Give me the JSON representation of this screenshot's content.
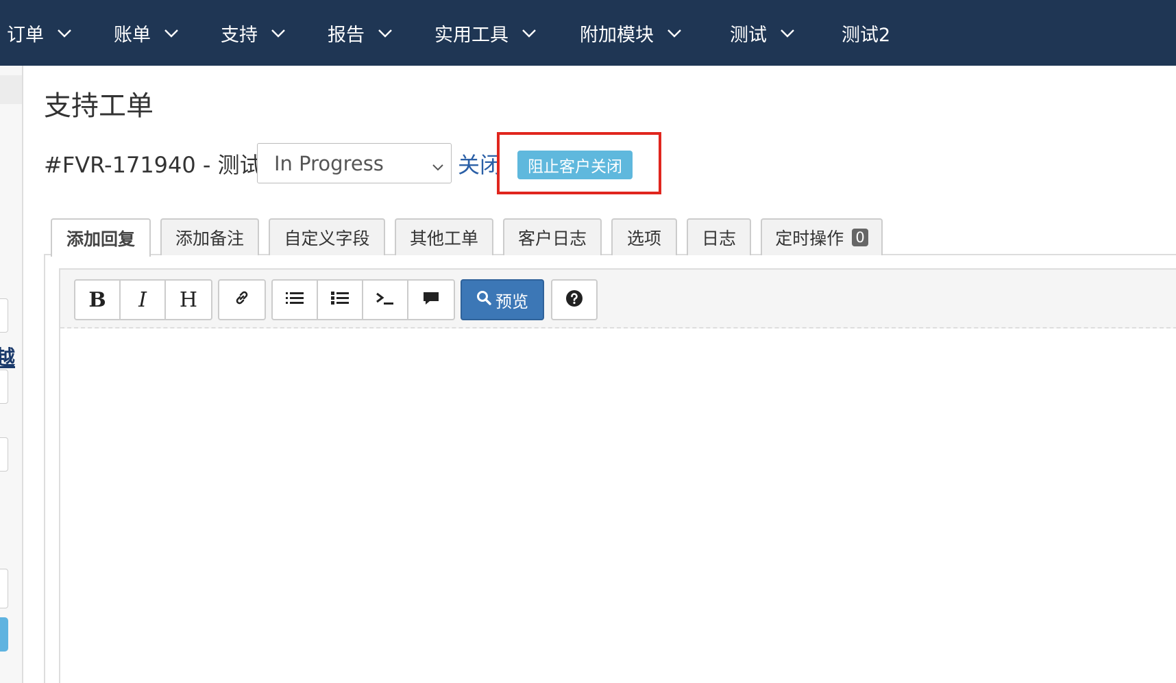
{
  "nav": {
    "items": [
      {
        "label": "订单",
        "has_dropdown": true
      },
      {
        "label": "账单",
        "has_dropdown": true
      },
      {
        "label": "支持",
        "has_dropdown": true
      },
      {
        "label": "报告",
        "has_dropdown": true
      },
      {
        "label": "实用工具",
        "has_dropdown": true
      },
      {
        "label": "附加模块",
        "has_dropdown": true
      },
      {
        "label": "测试",
        "has_dropdown": true
      },
      {
        "label": "测试2",
        "has_dropdown": false
      }
    ]
  },
  "sidebar": {
    "link_fragment": "越"
  },
  "page": {
    "title": "支持工单",
    "ticket_label": "#FVR-171940 - 测试",
    "status": {
      "selected": "In Progress"
    },
    "close_link": "关闭",
    "prevent_close_label": "阻止客户关闭"
  },
  "tabs": [
    {
      "label": "添加回复",
      "active": true
    },
    {
      "label": "添加备注",
      "active": false
    },
    {
      "label": "自定义字段",
      "active": false
    },
    {
      "label": "其他工单",
      "active": false
    },
    {
      "label": "客户日志",
      "active": false
    },
    {
      "label": "选项",
      "active": false
    },
    {
      "label": "日志",
      "active": false
    },
    {
      "label": "定时操作",
      "active": false,
      "count": "0"
    }
  ],
  "editor": {
    "toolbar": {
      "bold": "B",
      "italic": "I",
      "heading": "H",
      "preview_label": "预览"
    },
    "icons": {
      "bold": "bold-icon",
      "italic": "italic-icon",
      "heading": "heading-icon",
      "link": "link-icon",
      "ordered_list": "ordered-list-icon",
      "unordered_list": "unordered-list-icon",
      "code": "terminal-icon",
      "quote": "comment-icon",
      "preview": "search-icon",
      "help": "question-circle-icon"
    }
  },
  "colors": {
    "nav_bg": "#1f3654",
    "highlight": "#e0261e",
    "badge": "#5fb8dd",
    "primary_button": "#3c77b6",
    "link": "#2a5fa6"
  }
}
